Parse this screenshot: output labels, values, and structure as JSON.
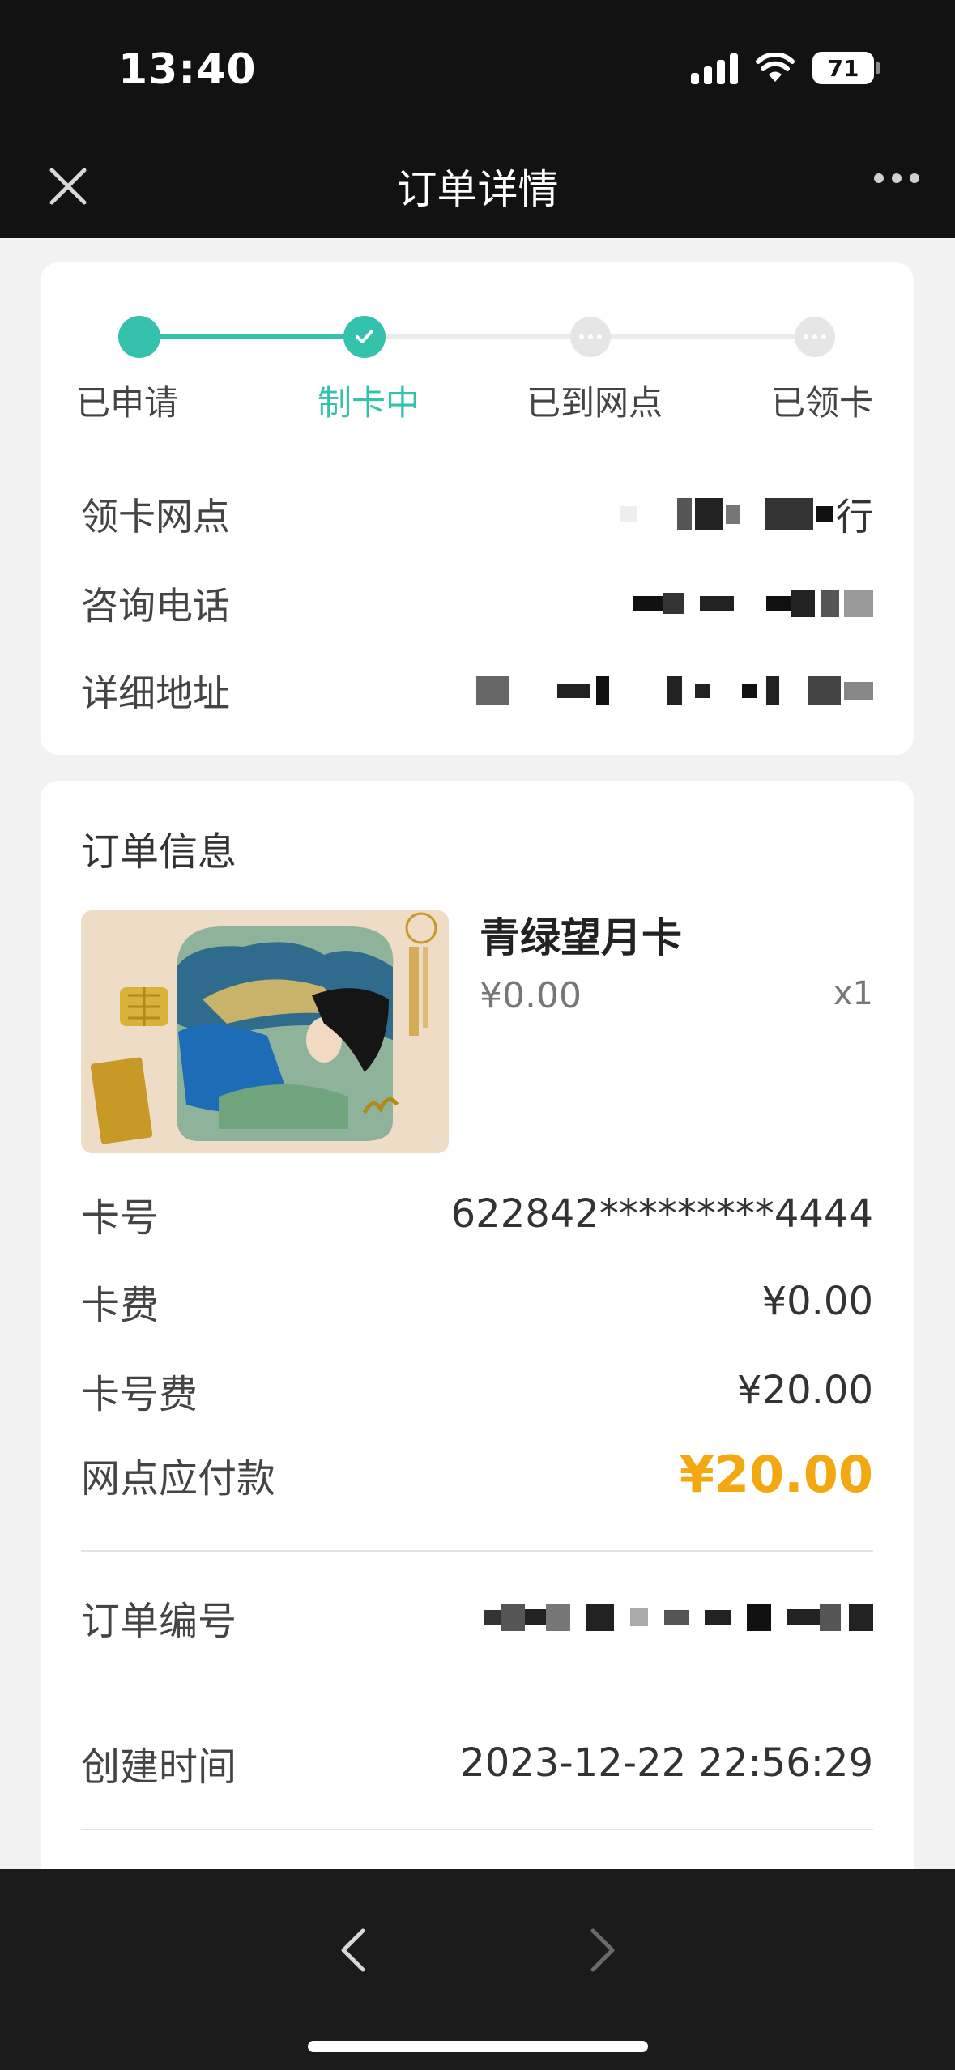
{
  "status": {
    "time": "13:40",
    "battery": "71"
  },
  "nav": {
    "title": "订单详情"
  },
  "progress": {
    "steps": [
      {
        "label": "已申请"
      },
      {
        "label": "制卡中"
      },
      {
        "label": "已到网点"
      },
      {
        "label": "已领卡"
      }
    ],
    "current": 1,
    "accent": "#35c2ad"
  },
  "branch": {
    "outlet_label": "领卡网点",
    "outlet_value_tail": "行",
    "phone_label": "咨询电话",
    "address_label": "详细地址"
  },
  "order": {
    "section_title": "订单信息",
    "product": {
      "name": "青绿望月卡",
      "price": "¥0.00",
      "qty": "x1"
    },
    "card_no_label": "卡号",
    "card_no_value": "622842*********4444",
    "card_fee_label": "卡费",
    "card_fee_value": "¥0.00",
    "number_fee_label": "卡号费",
    "number_fee_value": "¥20.00",
    "payable_label": "网点应付款",
    "payable_value": "¥20.00",
    "order_no_label": "订单编号",
    "created_label": "创建时间",
    "created_value": "2023-12-22 22:56:29",
    "accent": "#f3a812"
  }
}
